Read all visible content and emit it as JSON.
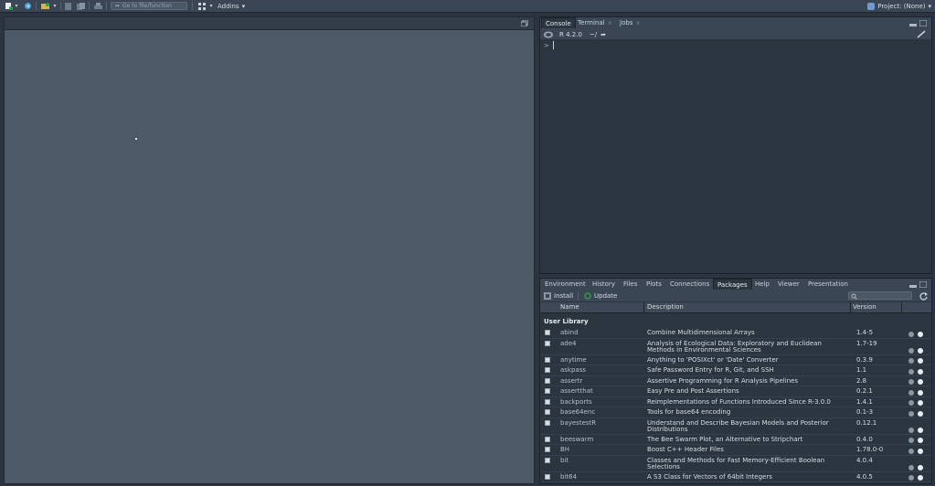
{
  "toolbar": {
    "goto_placeholder": "Go to file/function",
    "addins_label": "Addins",
    "project_label": "Project: (None)"
  },
  "console": {
    "tabs": [
      {
        "label": "Console",
        "active": true
      },
      {
        "label": "Terminal",
        "active": false
      },
      {
        "label": "Jobs",
        "active": false
      }
    ],
    "r_version": "R 4.2.0",
    "path": "~/",
    "prompt": ">"
  },
  "packages_pane": {
    "tabs": [
      {
        "label": "Environment"
      },
      {
        "label": "History"
      },
      {
        "label": "Files"
      },
      {
        "label": "Plots"
      },
      {
        "label": "Connections"
      },
      {
        "label": "Packages",
        "active": true
      },
      {
        "label": "Help"
      },
      {
        "label": "Viewer"
      },
      {
        "label": "Presentation"
      }
    ],
    "install_label": "Install",
    "update_label": "Update",
    "columns": {
      "name": "Name",
      "description": "Description",
      "version": "Version"
    },
    "section_label": "User Library",
    "packages": [
      {
        "name": "abind",
        "description": "Combine Multidimensional Arrays",
        "version": "1.4-5"
      },
      {
        "name": "ade4",
        "description": "Analysis of Ecological Data: Exploratory and Euclidean Methods in Environmental Sciences",
        "version": "1.7-19"
      },
      {
        "name": "anytime",
        "description": "Anything to 'POSIXct' or 'Date' Converter",
        "version": "0.3.9"
      },
      {
        "name": "askpass",
        "description": "Safe Password Entry for R, Git, and SSH",
        "version": "1.1"
      },
      {
        "name": "assertr",
        "description": "Assertive Programming for R Analysis Pipelines",
        "version": "2.8"
      },
      {
        "name": "assertthat",
        "description": "Easy Pre and Post Assertions",
        "version": "0.2.1"
      },
      {
        "name": "backports",
        "description": "Reimplementations of Functions Introduced Since R-3.0.0",
        "version": "1.4.1"
      },
      {
        "name": "base64enc",
        "description": "Tools for base64 encoding",
        "version": "0.1-3"
      },
      {
        "name": "bayestestR",
        "description": "Understand and Describe Bayesian Models and Posterior Distributions",
        "version": "0.12.1"
      },
      {
        "name": "beeswarm",
        "description": "The Bee Swarm Plot, an Alternative to Stripchart",
        "version": "0.4.0"
      },
      {
        "name": "BH",
        "description": "Boost C++ Header Files",
        "version": "1.78.0-0"
      },
      {
        "name": "bit",
        "description": "Classes and Methods for Fast Memory-Efficient Boolean Selections",
        "version": "4.0.4"
      },
      {
        "name": "bit64",
        "description": "A S3 Class for Vectors of 64bit Integers",
        "version": "4.0.5"
      }
    ]
  },
  "colors": {
    "accent": "#2f9e44",
    "background": "#2b3540",
    "editor": "#4c5a67"
  }
}
